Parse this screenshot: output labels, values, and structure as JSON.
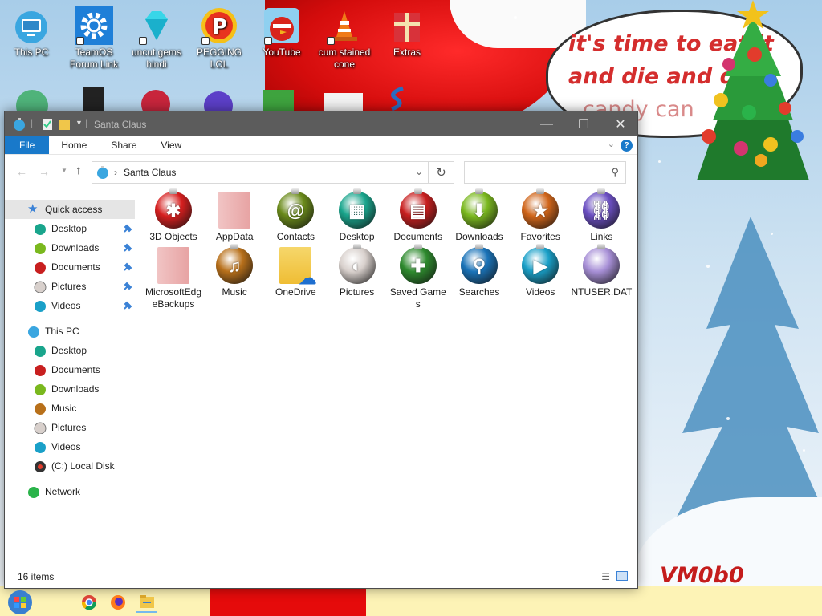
{
  "wallpaper": {
    "bubble_lines": [
      "it's time to eat it",
      "and die and d",
      "candy can"
    ],
    "signature": "VM0b0"
  },
  "desktop_icons": [
    {
      "label": "This PC",
      "icon": "monitor-icon"
    },
    {
      "label": "TeamOS Forum Link",
      "icon": "gear-icon"
    },
    {
      "label": "uncut gems hindi",
      "icon": "diamond-icon"
    },
    {
      "label": "PEGGING LOL",
      "icon": "p-logo-icon"
    },
    {
      "label": "YouTube",
      "icon": "angry-bird-icon"
    },
    {
      "label": "cum stained cone",
      "icon": "traffic-cone-icon"
    },
    {
      "label": "Extras",
      "icon": "gift-box-icon"
    }
  ],
  "window": {
    "title": "Santa Claus",
    "ribbon_tabs": [
      "File",
      "Home",
      "Share",
      "View"
    ],
    "address": "Santa Claus",
    "search_placeholder": "",
    "status": "16 items",
    "nav": {
      "quick_access": {
        "label": "Quick access",
        "items": [
          "Desktop",
          "Downloads",
          "Documents",
          "Pictures",
          "Videos"
        ]
      },
      "this_pc": {
        "label": "This PC",
        "items": [
          "Desktop",
          "Documents",
          "Downloads",
          "Music",
          "Pictures",
          "Videos",
          "(C:) Local Disk"
        ]
      },
      "network": {
        "label": "Network"
      }
    },
    "files": [
      {
        "name": "3D Objects",
        "icon": "3d-objects-icon",
        "color": "#d61f1f",
        "sym": "✱"
      },
      {
        "name": "AppData",
        "icon": "appdata-folder-icon",
        "color": "#e8b0b0",
        "sym": ""
      },
      {
        "name": "Contacts",
        "icon": "contacts-icon",
        "color": "#6a8a1a",
        "sym": "@"
      },
      {
        "name": "Desktop",
        "icon": "desktop-icon",
        "color": "#19a58c",
        "sym": "▦"
      },
      {
        "name": "Documents",
        "icon": "documents-icon",
        "color": "#c81f1f",
        "sym": "▤"
      },
      {
        "name": "Downloads",
        "icon": "downloads-icon",
        "color": "#7ab81e",
        "sym": "⬇"
      },
      {
        "name": "Favorites",
        "icon": "star-icon",
        "color": "#d0651a",
        "sym": "★"
      },
      {
        "name": "Links",
        "icon": "link-icon",
        "color": "#6b4fc2",
        "sym": "⛓"
      },
      {
        "name": "MicrosoftEdgeBackups",
        "icon": "edge-backups-folder-icon",
        "color": "#e8b0b0",
        "sym": ""
      },
      {
        "name": "Music",
        "icon": "headphones-icon",
        "color": "#b8701a",
        "sym": "♫"
      },
      {
        "name": "OneDrive",
        "icon": "onedrive-cloud-icon",
        "color": "#f0c24a",
        "sym": "☁"
      },
      {
        "name": "Pictures",
        "icon": "pictures-icon",
        "color": "#d8d0cc",
        "sym": "◐"
      },
      {
        "name": "Saved Games",
        "icon": "gamepad-icon",
        "color": "#2e8a2e",
        "sym": "✚"
      },
      {
        "name": "Searches",
        "icon": "magnifier-icon",
        "color": "#1a73b8",
        "sym": "⚲"
      },
      {
        "name": "Videos",
        "icon": "video-camera-icon",
        "color": "#1aa0c8",
        "sym": "▶"
      },
      {
        "name": "NTUSER.DAT",
        "icon": "data-file-icon",
        "color": "#a78fd6",
        "sym": ""
      }
    ]
  }
}
